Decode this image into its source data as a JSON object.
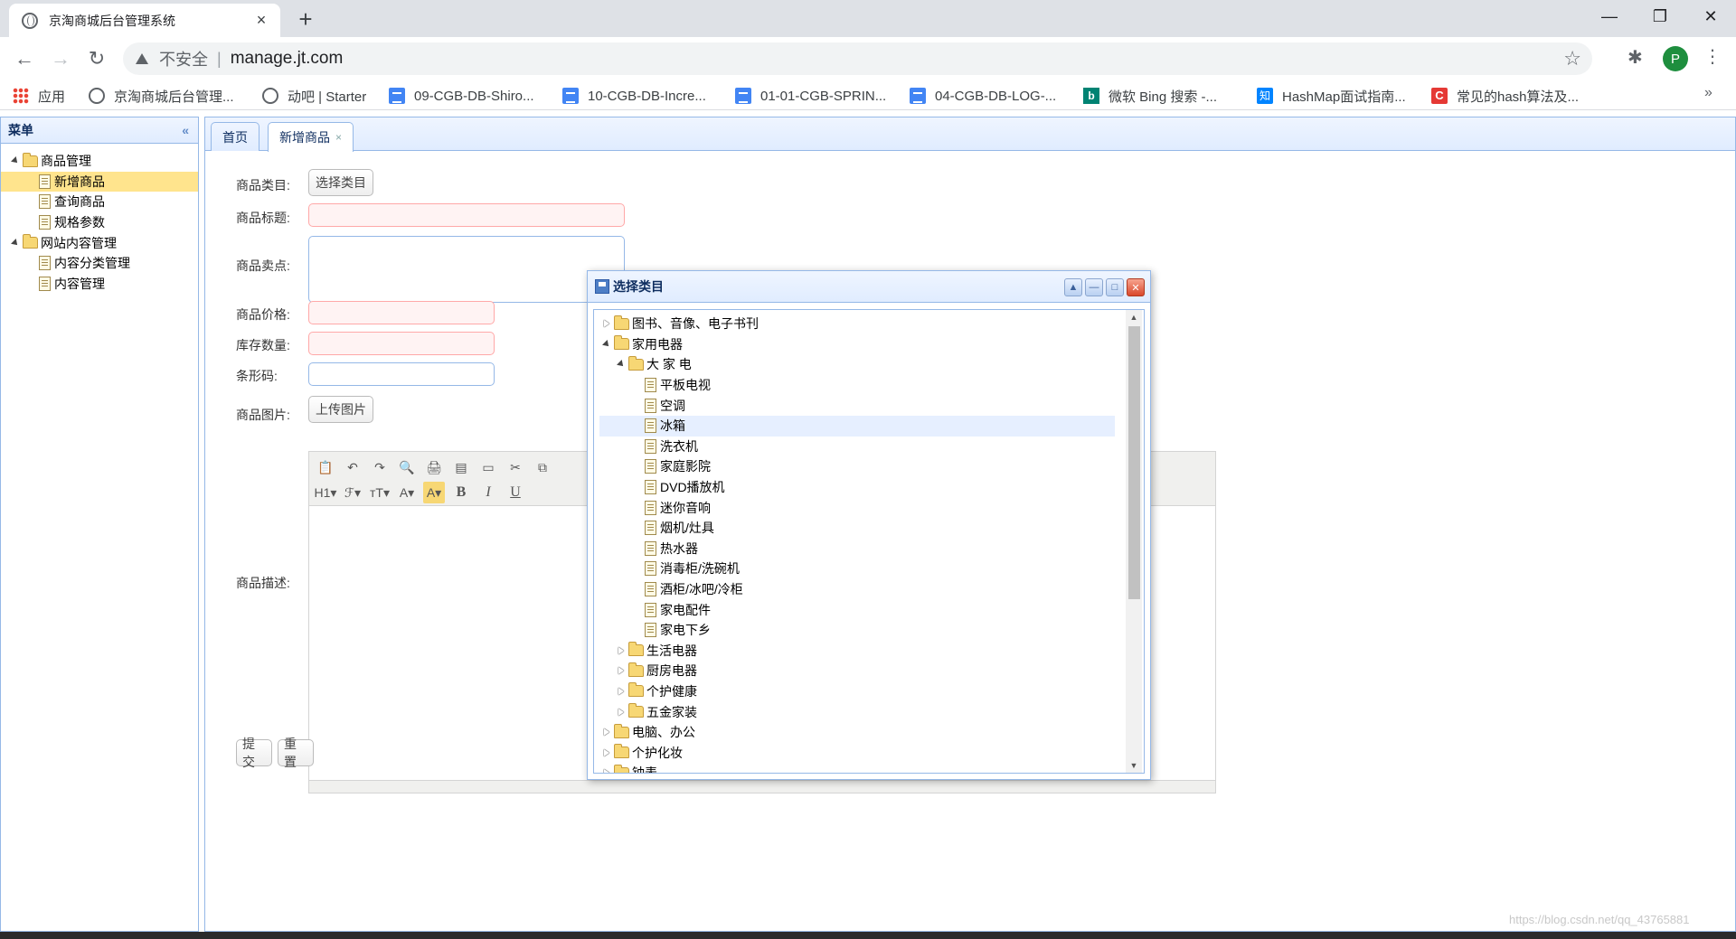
{
  "browser": {
    "tab_title": "京淘商城后台管理系统",
    "tab_close": "×",
    "new_tab": "+",
    "insecure_label": "不安全",
    "url": "manage.jt.com",
    "profile_initial": "P",
    "window": {
      "minimize": "—",
      "restore": "❐",
      "close": "✕"
    }
  },
  "bookmarks": [
    {
      "label": "应用",
      "icon": "apps-icon"
    },
    {
      "label": "京淘商城后台管理...",
      "icon": "globe-icon"
    },
    {
      "label": "动吧 | Starter",
      "icon": "globe-icon"
    },
    {
      "label": "09-CGB-DB-Shiro...",
      "icon": "doc-icon"
    },
    {
      "label": "10-CGB-DB-Incre...",
      "icon": "doc-icon"
    },
    {
      "label": "01-01-CGB-SPRIN...",
      "icon": "doc-icon"
    },
    {
      "label": "04-CGB-DB-LOG-...",
      "icon": "doc-icon"
    },
    {
      "label": "微软 Bing 搜索 -...",
      "icon": "bing-icon"
    },
    {
      "label": "HashMap面试指南...",
      "icon": "zhihu-icon"
    },
    {
      "label": "常见的hash算法及...",
      "icon": "csdn-icon"
    }
  ],
  "sidebar": {
    "title": "菜单",
    "tree": [
      {
        "label": "商品管理",
        "type": "folder",
        "level": 0,
        "open": true
      },
      {
        "label": "新增商品",
        "type": "file",
        "level": 1,
        "selected": true
      },
      {
        "label": "查询商品",
        "type": "file",
        "level": 1
      },
      {
        "label": "规格参数",
        "type": "file",
        "level": 1
      },
      {
        "label": "网站内容管理",
        "type": "folder",
        "level": 0,
        "open": true
      },
      {
        "label": "内容分类管理",
        "type": "file",
        "level": 1
      },
      {
        "label": "内容管理",
        "type": "file",
        "level": 1
      }
    ]
  },
  "tabs": [
    {
      "label": "首页"
    },
    {
      "label": "新增商品",
      "close": "×"
    }
  ],
  "form": {
    "category_label": "商品类目:",
    "category_button": "选择类目",
    "title_label": "商品标题:",
    "sellpoint_label": "商品卖点:",
    "price_label": "商品价格:",
    "stock_label": "库存数量:",
    "barcode_label": "条形码:",
    "image_label": "商品图片:",
    "upload_button": "上传图片",
    "desc_label": "商品描述:",
    "submit_button": "提交",
    "reset_button": "重置"
  },
  "editor": {
    "row1": [
      "📋",
      "↶",
      "↷",
      "🔍",
      "🖨",
      "▤",
      "▭",
      "✂",
      "⧉"
    ],
    "row2": [
      "H1▾",
      "ℱ▾",
      "тT▾",
      "A▾",
      "A▾",
      "B",
      "I",
      "U"
    ]
  },
  "dialog": {
    "title": "选择类目",
    "buttons": {
      "collapse": "▲",
      "minimize": "—",
      "maximize": "□",
      "close": "✕"
    },
    "tree": [
      {
        "label": "图书、音像、电子书刊",
        "type": "folder",
        "level": 0,
        "open": false
      },
      {
        "label": "家用电器",
        "type": "folder",
        "level": 0,
        "open": true
      },
      {
        "label": "大 家 电",
        "type": "folder",
        "level": 1,
        "open": true
      },
      {
        "label": "平板电视",
        "type": "file",
        "level": 2
      },
      {
        "label": "空调",
        "type": "file",
        "level": 2
      },
      {
        "label": "冰箱",
        "type": "file",
        "level": 2,
        "hover": true
      },
      {
        "label": "洗衣机",
        "type": "file",
        "level": 2
      },
      {
        "label": "家庭影院",
        "type": "file",
        "level": 2
      },
      {
        "label": "DVD播放机",
        "type": "file",
        "level": 2
      },
      {
        "label": "迷你音响",
        "type": "file",
        "level": 2
      },
      {
        "label": "烟机/灶具",
        "type": "file",
        "level": 2
      },
      {
        "label": "热水器",
        "type": "file",
        "level": 2
      },
      {
        "label": "消毒柜/洗碗机",
        "type": "file",
        "level": 2
      },
      {
        "label": "酒柜/冰吧/冷柜",
        "type": "file",
        "level": 2
      },
      {
        "label": "家电配件",
        "type": "file",
        "level": 2
      },
      {
        "label": "家电下乡",
        "type": "file",
        "level": 2
      },
      {
        "label": "生活电器",
        "type": "folder",
        "level": 1,
        "open": false
      },
      {
        "label": "厨房电器",
        "type": "folder",
        "level": 1,
        "open": false
      },
      {
        "label": "个护健康",
        "type": "folder",
        "level": 1,
        "open": false
      },
      {
        "label": "五金家装",
        "type": "folder",
        "level": 1,
        "open": false
      },
      {
        "label": "电脑、办公",
        "type": "folder",
        "level": 0,
        "open": false
      },
      {
        "label": "个护化妆",
        "type": "folder",
        "level": 0,
        "open": false
      },
      {
        "label": "钟表",
        "type": "folder",
        "level": 0,
        "open": false
      }
    ]
  },
  "watermark": "https://blog.csdn.net/qq_43765881",
  "colors": {
    "panel_border": "#95b8e7",
    "selected": "#ffe48d",
    "hover": "#e6efff"
  }
}
